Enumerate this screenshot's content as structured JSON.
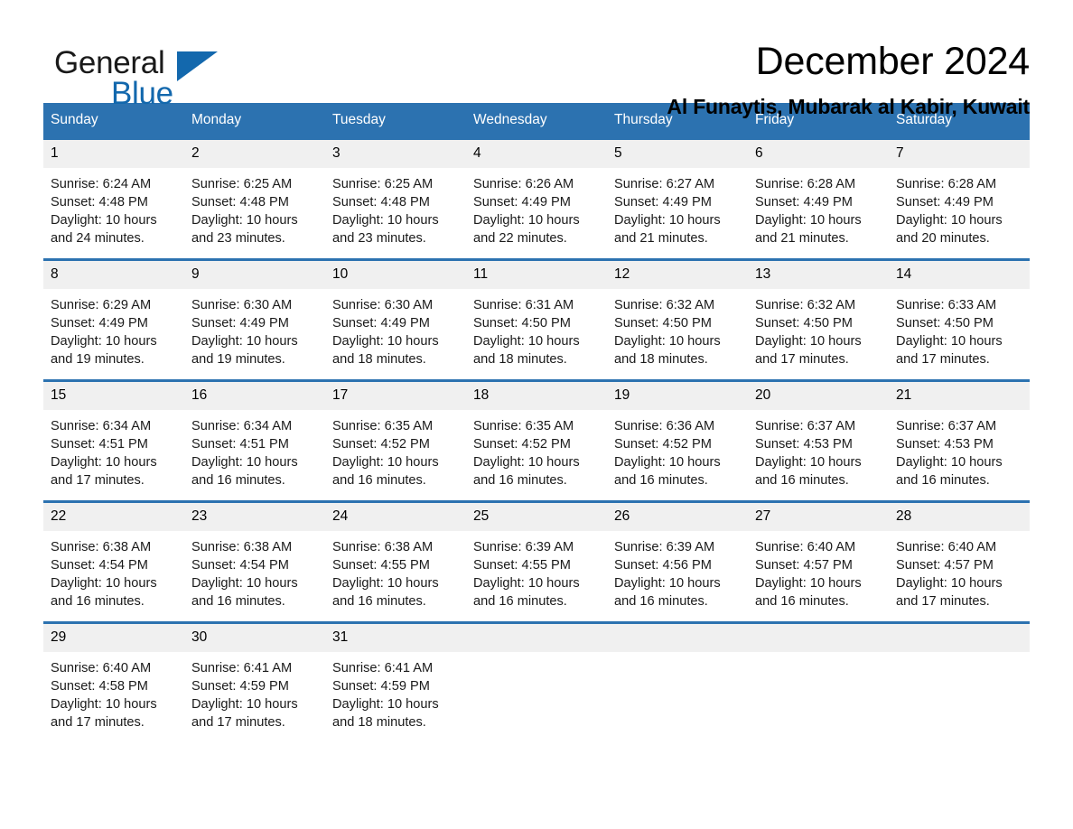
{
  "brand": {
    "name_part1": "General",
    "name_part2": "Blue",
    "triangle_color": "#1368ad"
  },
  "header": {
    "month_title": "December 2024",
    "location": "Al Funaytis, Mubarak al Kabir, Kuwait"
  },
  "calendar": {
    "header_bg": "#2c72b0",
    "daynum_bg": "#f0f0f0",
    "weekday_headers": [
      "Sunday",
      "Monday",
      "Tuesday",
      "Wednesday",
      "Thursday",
      "Friday",
      "Saturday"
    ],
    "weeks": [
      [
        {
          "day": "1",
          "sunrise": "Sunrise: 6:24 AM",
          "sunset": "Sunset: 4:48 PM",
          "daylight": "Daylight: 10 hours and 24 minutes."
        },
        {
          "day": "2",
          "sunrise": "Sunrise: 6:25 AM",
          "sunset": "Sunset: 4:48 PM",
          "daylight": "Daylight: 10 hours and 23 minutes."
        },
        {
          "day": "3",
          "sunrise": "Sunrise: 6:25 AM",
          "sunset": "Sunset: 4:48 PM",
          "daylight": "Daylight: 10 hours and 23 minutes."
        },
        {
          "day": "4",
          "sunrise": "Sunrise: 6:26 AM",
          "sunset": "Sunset: 4:49 PM",
          "daylight": "Daylight: 10 hours and 22 minutes."
        },
        {
          "day": "5",
          "sunrise": "Sunrise: 6:27 AM",
          "sunset": "Sunset: 4:49 PM",
          "daylight": "Daylight: 10 hours and 21 minutes."
        },
        {
          "day": "6",
          "sunrise": "Sunrise: 6:28 AM",
          "sunset": "Sunset: 4:49 PM",
          "daylight": "Daylight: 10 hours and 21 minutes."
        },
        {
          "day": "7",
          "sunrise": "Sunrise: 6:28 AM",
          "sunset": "Sunset: 4:49 PM",
          "daylight": "Daylight: 10 hours and 20 minutes."
        }
      ],
      [
        {
          "day": "8",
          "sunrise": "Sunrise: 6:29 AM",
          "sunset": "Sunset: 4:49 PM",
          "daylight": "Daylight: 10 hours and 19 minutes."
        },
        {
          "day": "9",
          "sunrise": "Sunrise: 6:30 AM",
          "sunset": "Sunset: 4:49 PM",
          "daylight": "Daylight: 10 hours and 19 minutes."
        },
        {
          "day": "10",
          "sunrise": "Sunrise: 6:30 AM",
          "sunset": "Sunset: 4:49 PM",
          "daylight": "Daylight: 10 hours and 18 minutes."
        },
        {
          "day": "11",
          "sunrise": "Sunrise: 6:31 AM",
          "sunset": "Sunset: 4:50 PM",
          "daylight": "Daylight: 10 hours and 18 minutes."
        },
        {
          "day": "12",
          "sunrise": "Sunrise: 6:32 AM",
          "sunset": "Sunset: 4:50 PM",
          "daylight": "Daylight: 10 hours and 18 minutes."
        },
        {
          "day": "13",
          "sunrise": "Sunrise: 6:32 AM",
          "sunset": "Sunset: 4:50 PM",
          "daylight": "Daylight: 10 hours and 17 minutes."
        },
        {
          "day": "14",
          "sunrise": "Sunrise: 6:33 AM",
          "sunset": "Sunset: 4:50 PM",
          "daylight": "Daylight: 10 hours and 17 minutes."
        }
      ],
      [
        {
          "day": "15",
          "sunrise": "Sunrise: 6:34 AM",
          "sunset": "Sunset: 4:51 PM",
          "daylight": "Daylight: 10 hours and 17 minutes."
        },
        {
          "day": "16",
          "sunrise": "Sunrise: 6:34 AM",
          "sunset": "Sunset: 4:51 PM",
          "daylight": "Daylight: 10 hours and 16 minutes."
        },
        {
          "day": "17",
          "sunrise": "Sunrise: 6:35 AM",
          "sunset": "Sunset: 4:52 PM",
          "daylight": "Daylight: 10 hours and 16 minutes."
        },
        {
          "day": "18",
          "sunrise": "Sunrise: 6:35 AM",
          "sunset": "Sunset: 4:52 PM",
          "daylight": "Daylight: 10 hours and 16 minutes."
        },
        {
          "day": "19",
          "sunrise": "Sunrise: 6:36 AM",
          "sunset": "Sunset: 4:52 PM",
          "daylight": "Daylight: 10 hours and 16 minutes."
        },
        {
          "day": "20",
          "sunrise": "Sunrise: 6:37 AM",
          "sunset": "Sunset: 4:53 PM",
          "daylight": "Daylight: 10 hours and 16 minutes."
        },
        {
          "day": "21",
          "sunrise": "Sunrise: 6:37 AM",
          "sunset": "Sunset: 4:53 PM",
          "daylight": "Daylight: 10 hours and 16 minutes."
        }
      ],
      [
        {
          "day": "22",
          "sunrise": "Sunrise: 6:38 AM",
          "sunset": "Sunset: 4:54 PM",
          "daylight": "Daylight: 10 hours and 16 minutes."
        },
        {
          "day": "23",
          "sunrise": "Sunrise: 6:38 AM",
          "sunset": "Sunset: 4:54 PM",
          "daylight": "Daylight: 10 hours and 16 minutes."
        },
        {
          "day": "24",
          "sunrise": "Sunrise: 6:38 AM",
          "sunset": "Sunset: 4:55 PM",
          "daylight": "Daylight: 10 hours and 16 minutes."
        },
        {
          "day": "25",
          "sunrise": "Sunrise: 6:39 AM",
          "sunset": "Sunset: 4:55 PM",
          "daylight": "Daylight: 10 hours and 16 minutes."
        },
        {
          "day": "26",
          "sunrise": "Sunrise: 6:39 AM",
          "sunset": "Sunset: 4:56 PM",
          "daylight": "Daylight: 10 hours and 16 minutes."
        },
        {
          "day": "27",
          "sunrise": "Sunrise: 6:40 AM",
          "sunset": "Sunset: 4:57 PM",
          "daylight": "Daylight: 10 hours and 16 minutes."
        },
        {
          "day": "28",
          "sunrise": "Sunrise: 6:40 AM",
          "sunset": "Sunset: 4:57 PM",
          "daylight": "Daylight: 10 hours and 17 minutes."
        }
      ],
      [
        {
          "day": "29",
          "sunrise": "Sunrise: 6:40 AM",
          "sunset": "Sunset: 4:58 PM",
          "daylight": "Daylight: 10 hours and 17 minutes."
        },
        {
          "day": "30",
          "sunrise": "Sunrise: 6:41 AM",
          "sunset": "Sunset: 4:59 PM",
          "daylight": "Daylight: 10 hours and 17 minutes."
        },
        {
          "day": "31",
          "sunrise": "Sunrise: 6:41 AM",
          "sunset": "Sunset: 4:59 PM",
          "daylight": "Daylight: 10 hours and 18 minutes."
        },
        {
          "day": "",
          "sunrise": "",
          "sunset": "",
          "daylight": ""
        },
        {
          "day": "",
          "sunrise": "",
          "sunset": "",
          "daylight": ""
        },
        {
          "day": "",
          "sunrise": "",
          "sunset": "",
          "daylight": ""
        },
        {
          "day": "",
          "sunrise": "",
          "sunset": "",
          "daylight": ""
        }
      ]
    ]
  }
}
